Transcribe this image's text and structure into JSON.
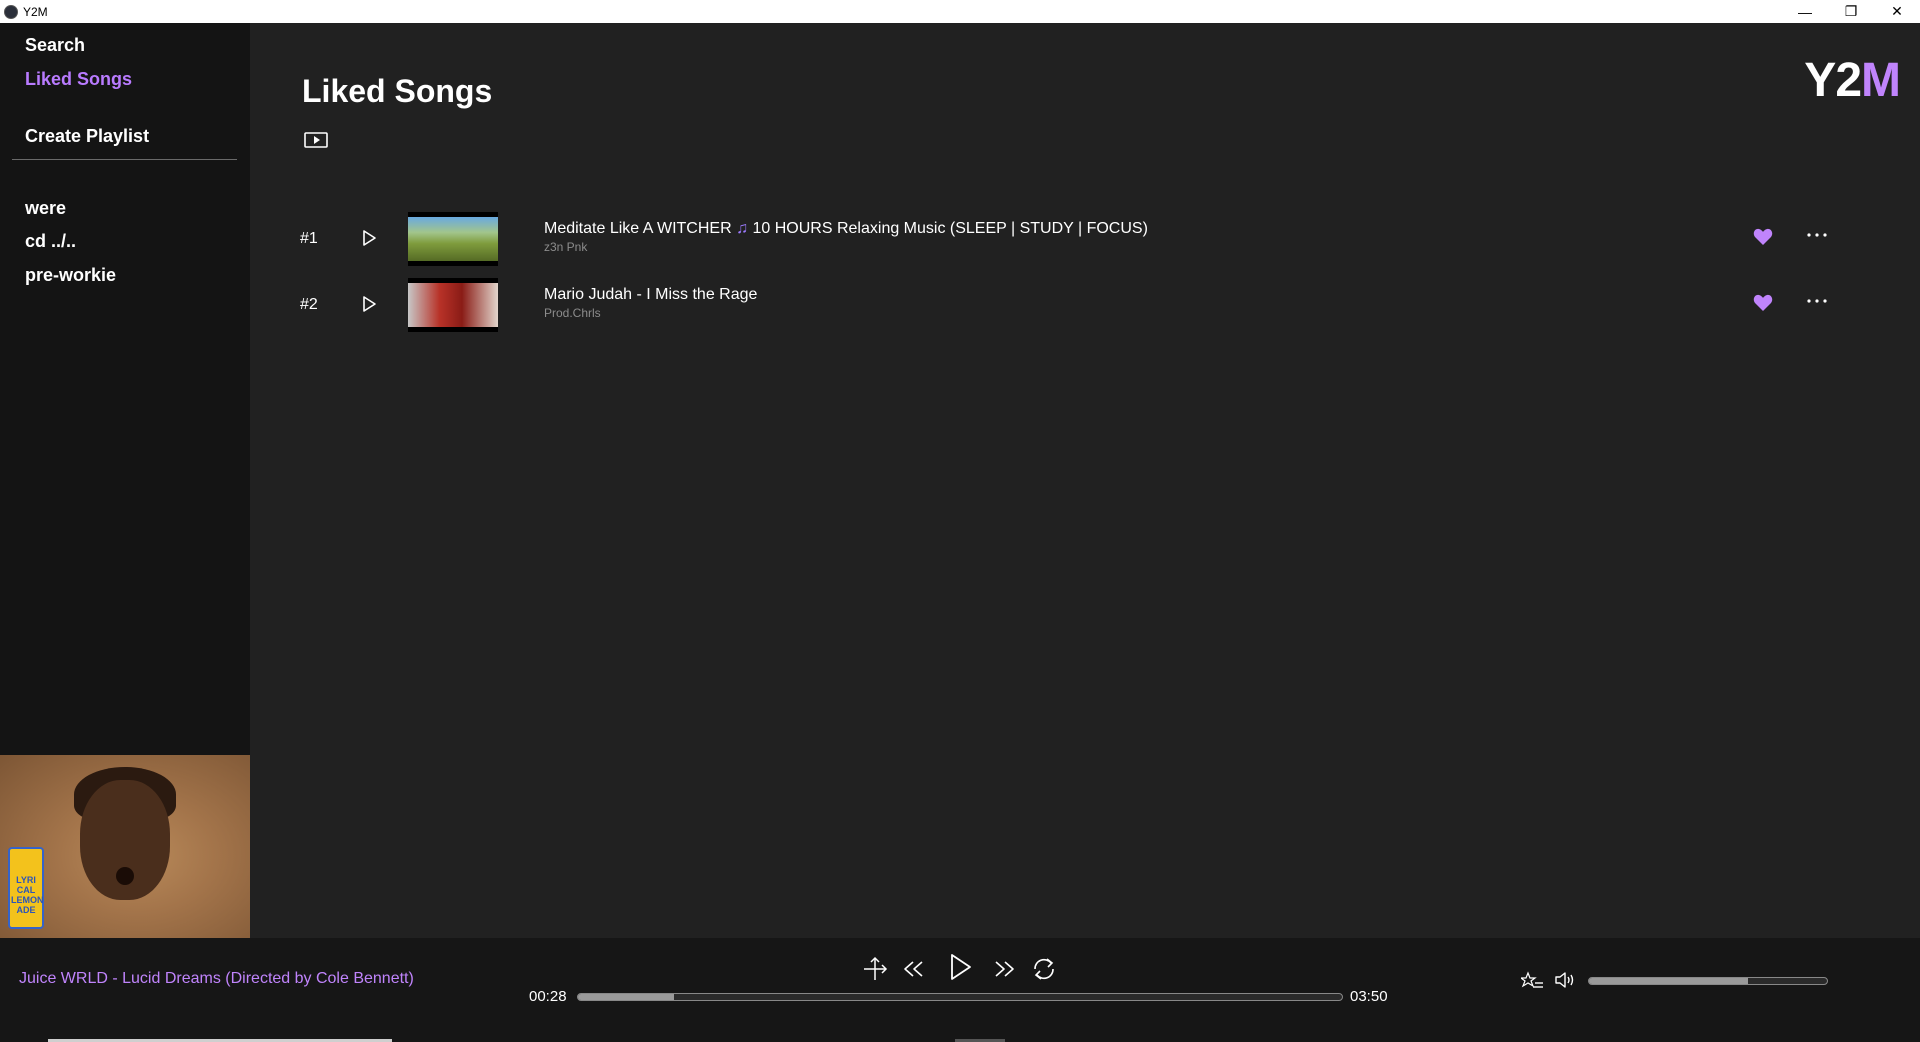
{
  "window": {
    "title": "Y2M",
    "minimize_glyph": "—",
    "restore_glyph": "❐",
    "close_glyph": "✕"
  },
  "sidebar": {
    "nav": [
      {
        "label": "Search",
        "active": false
      },
      {
        "label": "Liked Songs",
        "active": true
      }
    ],
    "create_playlist_label": "Create Playlist",
    "playlists": [
      "were",
      "cd ../..",
      "pre-workie"
    ],
    "now_playing_art_text": "LYRI CAL LEMON ADE"
  },
  "main": {
    "page_title": "Liked Songs",
    "logo_main": "Y2",
    "logo_accent": "M",
    "tracks": [
      {
        "index": "#1",
        "title_before": "Meditate Like A WITCHER ",
        "title_note": "♫",
        "title_after": " 10 HOURS Relaxing Music (SLEEP | STUDY | FOCUS)",
        "artist": "z3n Pnk",
        "liked": true
      },
      {
        "index": "#2",
        "title_before": "Mario Judah - I Miss the Rage",
        "title_note": "",
        "title_after": "",
        "artist": "Prod.Chrls",
        "liked": true
      }
    ]
  },
  "player": {
    "now_playing": "Juice WRLD - Lucid Dreams (Directed by Cole Bennett)",
    "elapsed": "00:28",
    "duration": "03:50",
    "progress_fraction": 0.126,
    "volume_fraction": 0.67
  },
  "colors": {
    "accent": "#c084fc",
    "sidebar_bg": "#141414",
    "main_bg": "#212121",
    "player_bg": "#161616"
  },
  "icons": [
    "view-mode-icon",
    "play-icon",
    "heart-icon",
    "more-icon",
    "shuffle-icon",
    "rewind-icon",
    "forward-icon",
    "repeat-icon",
    "queue-icon",
    "volume-icon"
  ]
}
